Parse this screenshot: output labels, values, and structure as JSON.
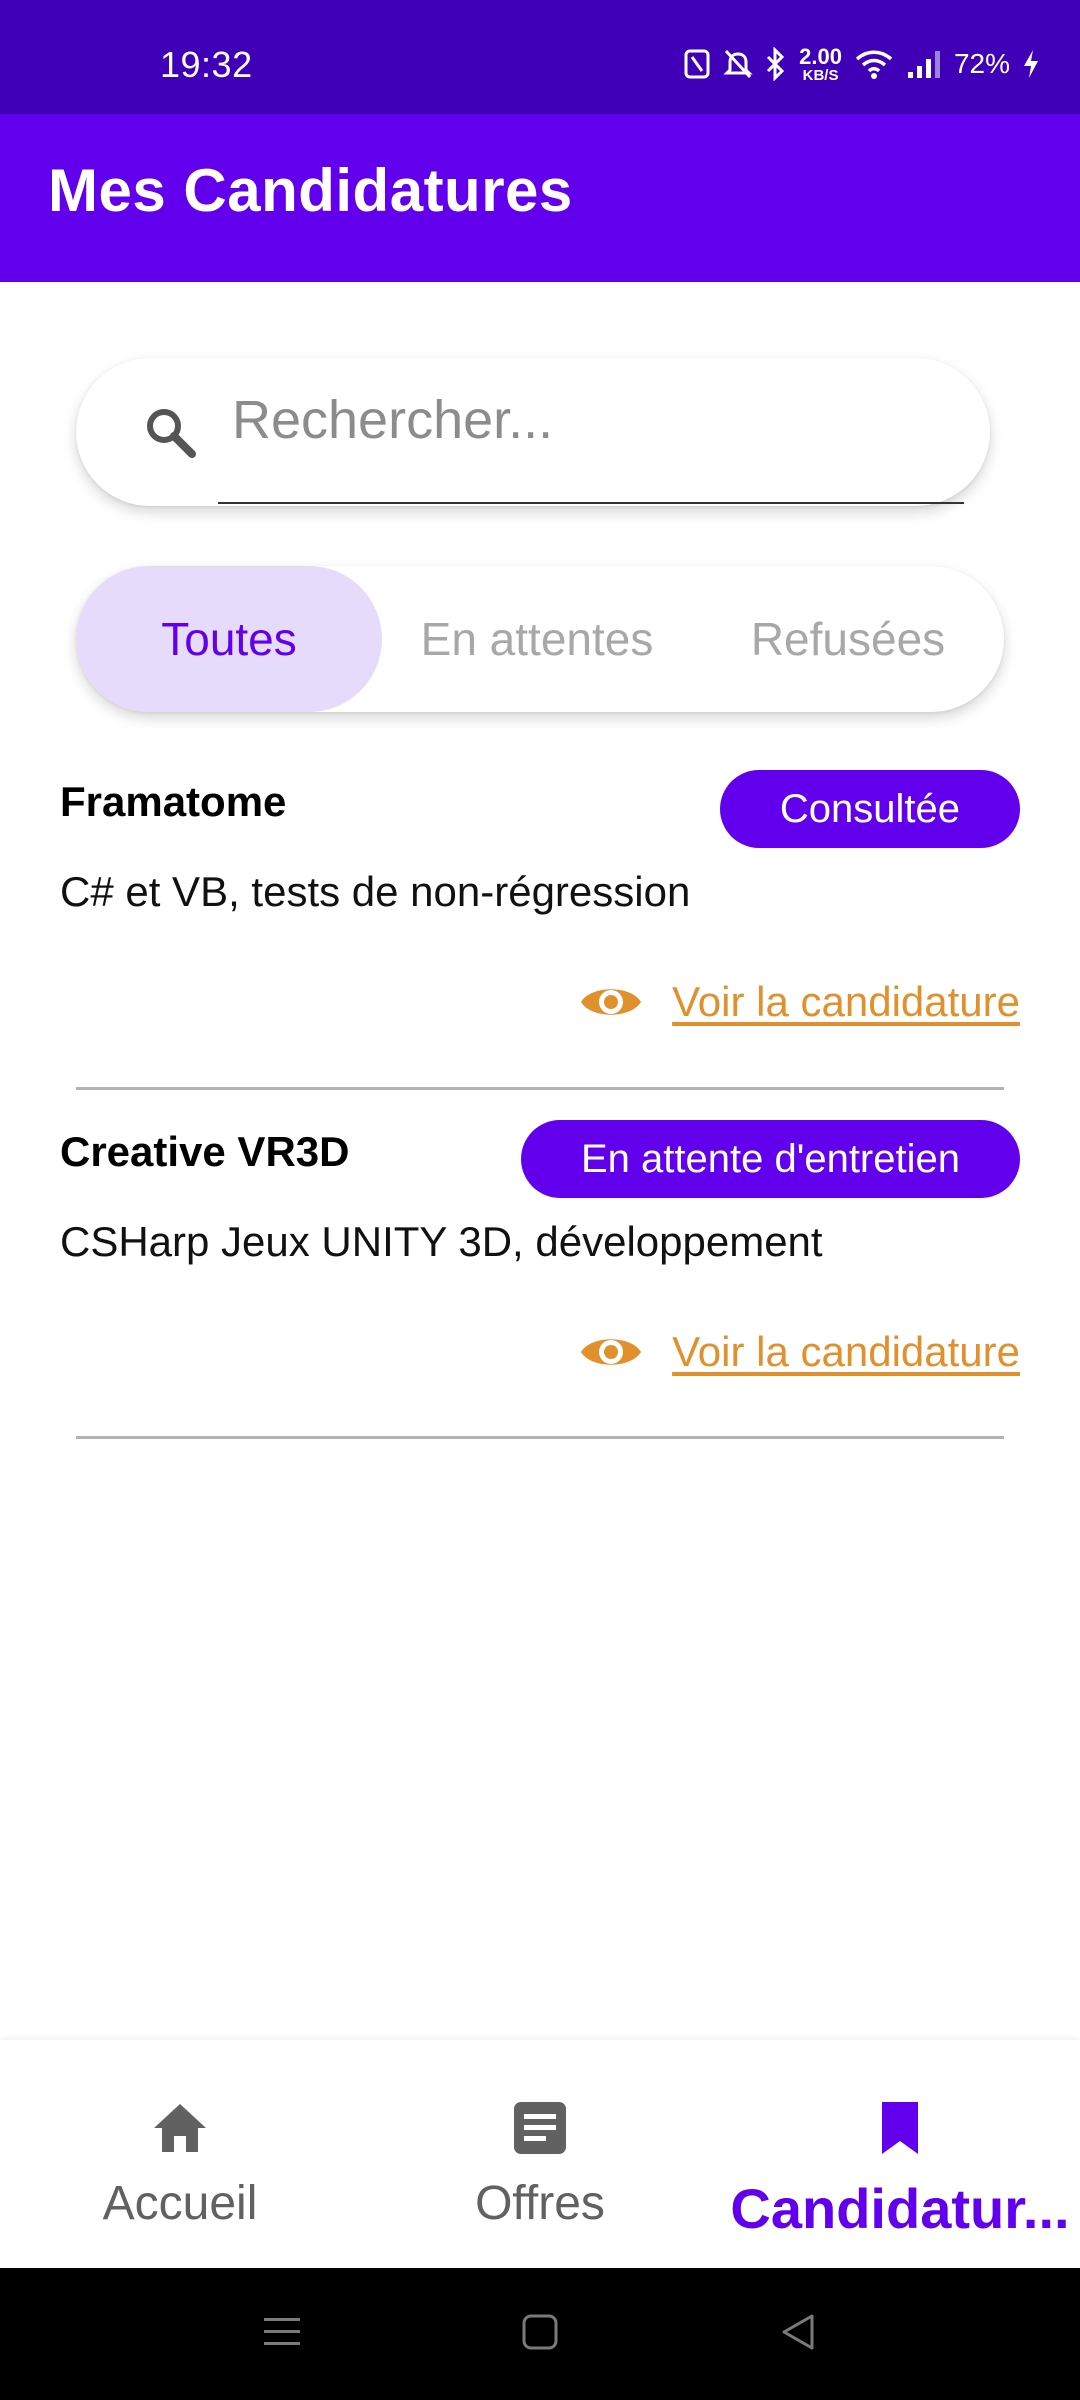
{
  "status_bar": {
    "time": "19:32",
    "net_speed_value": "2.00",
    "net_speed_unit": "KB/S",
    "battery": "72%",
    "icons": [
      "nfc-icon",
      "bell-off-icon",
      "bluetooth-icon",
      "wifi-icon",
      "signal-icon",
      "charging-icon"
    ]
  },
  "app_bar": {
    "title": "Mes Candidatures"
  },
  "search": {
    "placeholder": "Rechercher..."
  },
  "tabs": [
    {
      "label": "Toutes",
      "active": true
    },
    {
      "label": "En attentes",
      "active": false
    },
    {
      "label": "Refusées",
      "active": false
    }
  ],
  "applications": [
    {
      "company": "Framatome",
      "status": "Consultée",
      "description": "C# et VB, tests de non-régression",
      "link_label": "Voir la candidature"
    },
    {
      "company": "Creative VR3D",
      "status": "En attente d'entretien",
      "description": "CSHarp Jeux UNITY 3D, développement",
      "link_label": "Voir la candidature"
    }
  ],
  "bottom_nav": [
    {
      "label": "Accueil",
      "icon": "home-icon",
      "active": false
    },
    {
      "label": "Offres",
      "icon": "article-icon",
      "active": false
    },
    {
      "label": "Candidatur...",
      "icon": "bookmark-icon",
      "active": true
    }
  ],
  "colors": {
    "status_bar": "#3f00b8",
    "primary": "#6200ee",
    "tab_active_bg": "#e6dbfa",
    "link": "#e0902c",
    "inactive_tab_text": "#a8a8a8"
  }
}
